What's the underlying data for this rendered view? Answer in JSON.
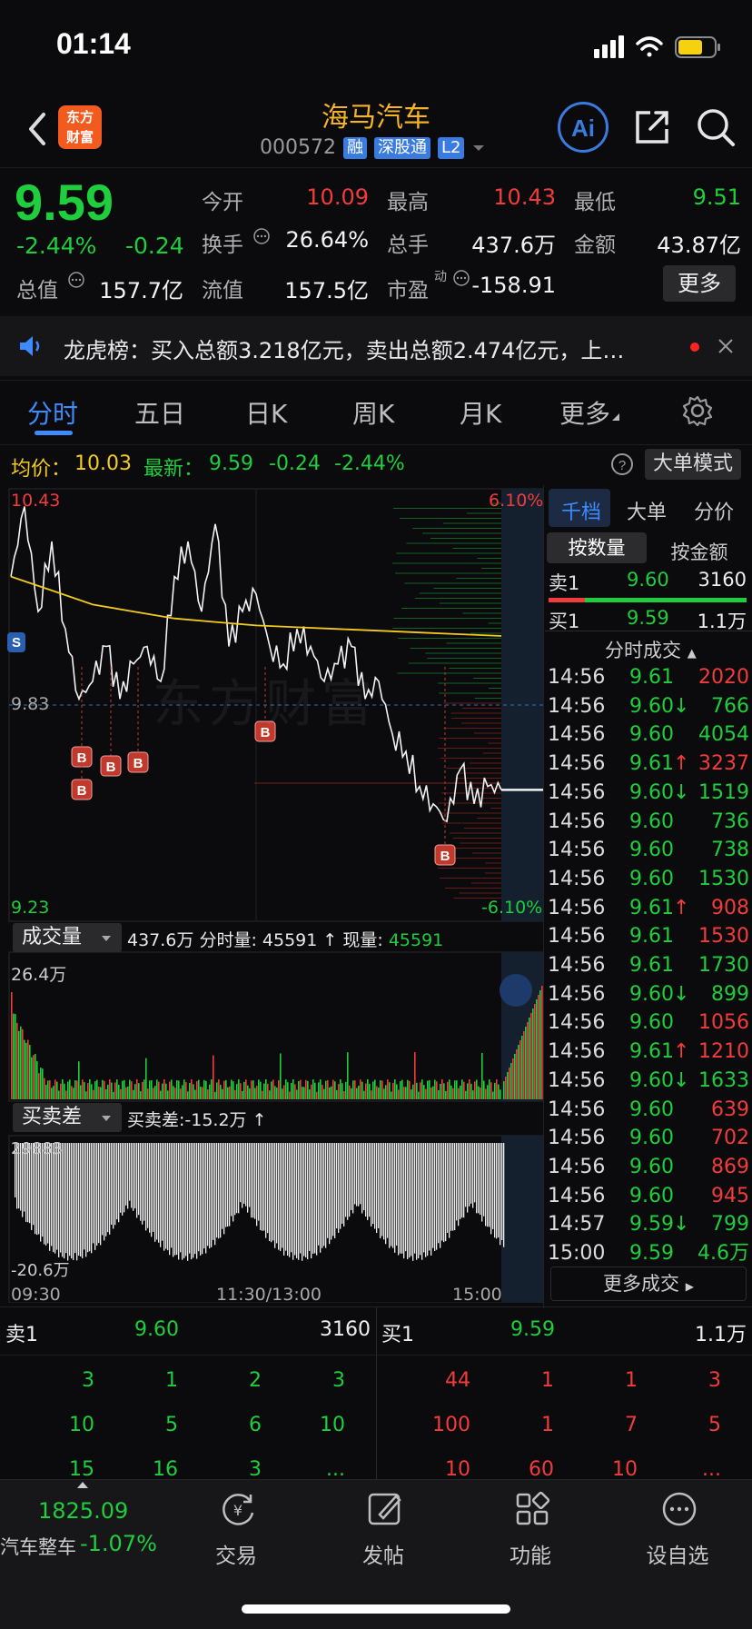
{
  "status": {
    "time": "01:14"
  },
  "header": {
    "logo_line1": "东方",
    "logo_line2": "财富",
    "title": "海马汽车",
    "code": "000572",
    "tags": [
      "融",
      "深股通",
      "L2"
    ],
    "ai_label": "Ai"
  },
  "quote": {
    "price": "9.59",
    "change_pct": "-2.44%",
    "change": "-0.24",
    "open_label": "今开",
    "open": "10.09",
    "high_label": "最高",
    "high": "10.43",
    "low_label": "最低",
    "low": "9.51",
    "turnover_label": "换手",
    "turnover": "26.64%",
    "volume_label": "总手",
    "volume": "437.6万",
    "amount_label": "金额",
    "amount": "43.87亿",
    "mktcap_label": "总值",
    "mktcap": "157.7亿",
    "float_label": "流值",
    "float": "157.5亿",
    "pe_label": "市盈",
    "pe_sup": "动",
    "pe": "-158.91",
    "more": "更多"
  },
  "notice": {
    "text": "龙虎榜：买入总额3.218亿元，卖出总额2.474亿元，上…"
  },
  "tabs": [
    "分时",
    "五日",
    "日K",
    "周K",
    "月K",
    "更多"
  ],
  "infobar": {
    "avg_label": "均价：",
    "avg": "10.03",
    "latest_label": "最新：",
    "latest": "9.59",
    "latest_chg": "-0.24",
    "latest_pct": "-2.44%",
    "mode_button": "大单模式"
  },
  "chart": {
    "y_top": "10.43",
    "y_mid": "9.83",
    "y_bottom": "9.23",
    "pct_top": "6.10%",
    "pct_bottom": "-6.10%",
    "watermark": "东方财富",
    "volume_selector": "成交量",
    "volume_info_total": "437.6万",
    "volume_info_label": "分时量:",
    "volume_info_value": "45591",
    "volume_info_now_label": "现量:",
    "volume_info_now": "45591",
    "volume_max": "26.4万",
    "diff_selector": "买卖差",
    "diff_info": "买卖差:-15.2万",
    "diff_top": "29883",
    "diff_bottom": "-20.6万",
    "x_labels": [
      "09:30",
      "11:30/13:00",
      "15:00"
    ]
  },
  "chart_data": {
    "type": "line",
    "title": "",
    "series": [
      {
        "name": "均价",
        "values": [
          10.03
        ]
      },
      {
        "name": "最新",
        "values": [
          9.59
        ]
      }
    ],
    "ylim": [
      9.23,
      10.43
    ],
    "yticks": [
      "10.43",
      "9.83",
      "9.23"
    ],
    "xticks": [
      "09:30",
      "11:30/13:00",
      "15:00"
    ],
    "price_path": [
      10.2,
      10.4,
      10.1,
      10.3,
      10.05,
      9.85,
      9.9,
      10.0,
      9.85,
      9.95,
      10.0,
      9.9,
      10.2,
      10.3,
      10.1,
      10.35,
      10.0,
      10.1,
      10.15,
      10.0,
      9.95,
      10.05,
      10.0,
      9.9,
      9.95,
      10.0,
      9.85,
      9.9,
      9.75,
      9.7,
      9.6,
      9.55,
      9.5,
      9.65,
      9.55,
      9.6,
      9.59
    ],
    "avg_path": [
      10.2,
      10.16,
      10.12,
      10.1,
      10.08,
      10.07,
      10.06,
      10.055,
      10.05,
      10.045,
      10.04,
      10.035,
      10.03
    ],
    "signals": [
      "B",
      "B",
      "B",
      "B",
      "B",
      "B",
      "S"
    ]
  },
  "right_panel": {
    "tabs": [
      "千档",
      "大单",
      "分价"
    ],
    "subtabs": [
      "按数量",
      "按金额"
    ],
    "sell1": {
      "label": "卖1",
      "price": "9.60",
      "vol": "3160"
    },
    "buy1": {
      "label": "买1",
      "price": "9.59",
      "vol": "1.1万"
    },
    "ticks_title": "分时成交",
    "ticks": [
      {
        "time": "14:56",
        "price": "9.61",
        "arrow": "",
        "vol": "2020",
        "color": "red"
      },
      {
        "time": "14:56",
        "price": "9.60",
        "arrow": "↓",
        "vol": "766",
        "color": "green"
      },
      {
        "time": "14:56",
        "price": "9.60",
        "arrow": "",
        "vol": "4054",
        "color": "green"
      },
      {
        "time": "14:56",
        "price": "9.61",
        "arrow": "↑",
        "vol": "3237",
        "color": "red"
      },
      {
        "time": "14:56",
        "price": "9.60",
        "arrow": "↓",
        "vol": "1519",
        "color": "green"
      },
      {
        "time": "14:56",
        "price": "9.60",
        "arrow": "",
        "vol": "736",
        "color": "green"
      },
      {
        "time": "14:56",
        "price": "9.60",
        "arrow": "",
        "vol": "738",
        "color": "green"
      },
      {
        "time": "14:56",
        "price": "9.60",
        "arrow": "",
        "vol": "1530",
        "color": "green"
      },
      {
        "time": "14:56",
        "price": "9.61",
        "arrow": "↑",
        "vol": "908",
        "color": "red"
      },
      {
        "time": "14:56",
        "price": "9.61",
        "arrow": "",
        "vol": "1530",
        "color": "red"
      },
      {
        "time": "14:56",
        "price": "9.61",
        "arrow": "",
        "vol": "1730",
        "color": "green"
      },
      {
        "time": "14:56",
        "price": "9.60",
        "arrow": "↓",
        "vol": "899",
        "color": "green"
      },
      {
        "time": "14:56",
        "price": "9.60",
        "arrow": "",
        "vol": "1056",
        "color": "red"
      },
      {
        "time": "14:56",
        "price": "9.61",
        "arrow": "↑",
        "vol": "1210",
        "color": "red"
      },
      {
        "time": "14:56",
        "price": "9.60",
        "arrow": "↓",
        "vol": "1633",
        "color": "green"
      },
      {
        "time": "14:56",
        "price": "9.60",
        "arrow": "",
        "vol": "639",
        "color": "red"
      },
      {
        "time": "14:56",
        "price": "9.60",
        "arrow": "",
        "vol": "702",
        "color": "red"
      },
      {
        "time": "14:56",
        "price": "9.60",
        "arrow": "",
        "vol": "869",
        "color": "red"
      },
      {
        "time": "14:56",
        "price": "9.60",
        "arrow": "",
        "vol": "945",
        "color": "red"
      },
      {
        "time": "14:57",
        "price": "9.59",
        "arrow": "↓",
        "vol": "799",
        "color": "green"
      },
      {
        "time": "15:00",
        "price": "9.59",
        "arrow": "",
        "vol": "4.6万",
        "color": "green"
      }
    ],
    "more_ticks": "更多成交"
  },
  "book": {
    "sell": {
      "label": "卖1",
      "price": "9.60",
      "vol": "3160",
      "rows": [
        [
          "3",
          "1",
          "2",
          "3"
        ],
        [
          "10",
          "5",
          "6",
          "10"
        ],
        [
          "15",
          "16",
          "3",
          "..."
        ]
      ]
    },
    "buy": {
      "label": "买1",
      "price": "9.59",
      "vol": "1.1万",
      "rows": [
        [
          "44",
          "1",
          "1",
          "3"
        ],
        [
          "100",
          "1",
          "7",
          "5"
        ],
        [
          "10",
          "60",
          "10",
          "..."
        ]
      ]
    }
  },
  "bottom_nav": {
    "index_value": "1825.09",
    "index_name": "汽车整车",
    "index_pct": "-1.07%",
    "items": [
      "交易",
      "发帖",
      "功能",
      "设自选"
    ]
  }
}
